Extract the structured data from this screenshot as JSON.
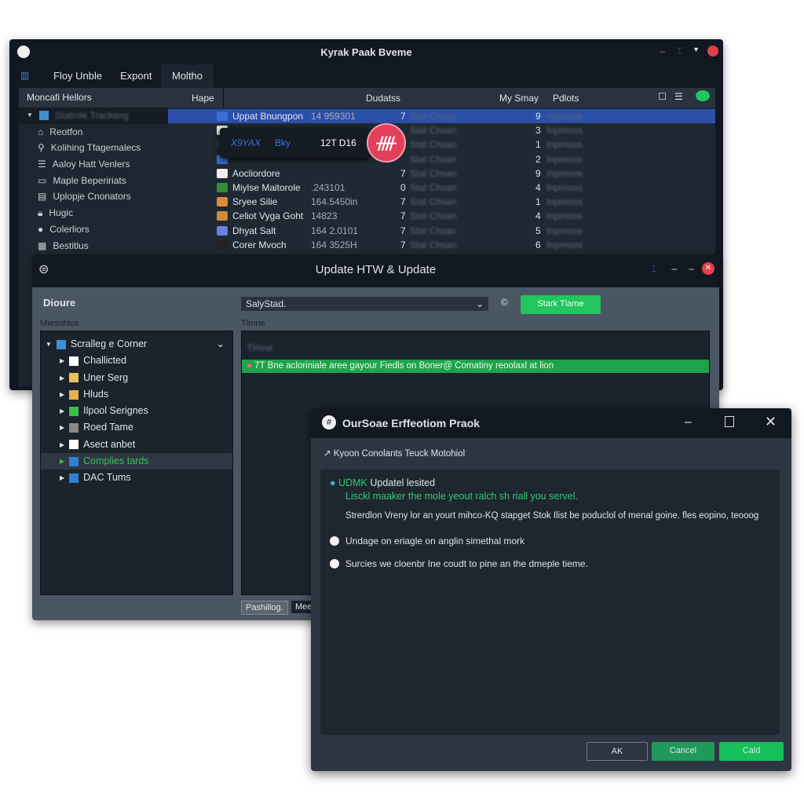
{
  "main_window": {
    "title": "Kyrak Paak Bveme",
    "tabs": [
      "Floy Unble",
      "Expont",
      "Moltho"
    ],
    "sidebar": {
      "header": "Moncafi Hellors",
      "items": [
        "Reotfon",
        "Kolihing Tfagemalecs",
        "Aaloy Hatt Venlers",
        "Maple Bepeririats",
        "Uplopje Cnonators",
        "Hugic",
        "Colerliors",
        "Bestitlus"
      ]
    },
    "table": {
      "columns": [
        "Hape",
        "Dudatss",
        "My Smay",
        "Pdlots"
      ],
      "rows": [
        {
          "name": "Uppat Bnungpon",
          "size": "14 959301",
          "count": "7",
          "my": "9",
          "pilots": "Inpmoos"
        },
        {
          "name": "",
          "size": "",
          "count": "",
          "my": "3",
          "pilots": "Inpmoos"
        },
        {
          "name": "",
          "size": "",
          "count": "",
          "my": "1",
          "pilots": "Inpmoos"
        },
        {
          "name": "",
          "size": "",
          "count": "",
          "my": "2",
          "pilots": "Inpmoos"
        },
        {
          "name": "Aocliordore",
          "size": "",
          "count": "7",
          "my": "9",
          "pilots": "Inpmoos"
        },
        {
          "name": "Miylse Maitorole",
          "size": ".243101",
          "count": "0",
          "my": "4",
          "pilots": "Inpmoos"
        },
        {
          "name": "Sryee Silie",
          "size": "164.5450in",
          "count": "7",
          "my": "1",
          "pilots": "Inpmoos"
        },
        {
          "name": "Celiot Vyga Goht",
          "size": "14823",
          "count": "7",
          "my": "4",
          "pilots": "Inpmoos"
        },
        {
          "name": "Dhyat Salt",
          "size": "164 2.0101",
          "count": "7",
          "my": "5",
          "pilots": "Inpmoos"
        },
        {
          "name": "Corer Mvoch",
          "size": "164 3525H",
          "count": "7",
          "my": "6",
          "pilots": "Inpmoos"
        }
      ]
    },
    "popup": {
      "a": "X9YAX",
      "b": "Bky",
      "c": "12T D16"
    }
  },
  "update_window": {
    "title": "Update HTW & Update",
    "left_label": "Dioure",
    "select_value": "SalyStad.",
    "start_button": "Stark Tlame",
    "tree_label": "Miesohlos",
    "list_label": "Tlmne",
    "tree": [
      {
        "label": "Scralleg e Corner",
        "color": "#3a8fd6"
      },
      {
        "label": "Challicted",
        "color": "#ffffff"
      },
      {
        "label": "Uner Serg",
        "color": "#e8c15a"
      },
      {
        "label": "Hluds",
        "color": "#e8b04a"
      },
      {
        "label": "Ilpool Serignes",
        "color": "#3cbf4a"
      },
      {
        "label": "Roed Tame",
        "color": "#888888"
      },
      {
        "label": "Asect anbet",
        "color": "#ffffff"
      },
      {
        "label": "Complies tards",
        "color": "#2f7fd6"
      },
      {
        "label": "DAC Tums",
        "color": "#2f7fd6"
      }
    ],
    "highlight": "7T Bne acloriniale aree gayour Fiedls on Boner@ Comatiny reoolaxl at lion",
    "bottom_tabs": [
      "Pashillog.",
      "Mee"
    ]
  },
  "dialog": {
    "title": "OurSoae Erffeotiom Praok",
    "subtitle": "Kyoon Conolants Teuck Motohiol",
    "status_prefix": "UDMK",
    "status": "Updatel lesited",
    "green_line": "Lisckl maaker the mole yeout ralch sh riall you servel.",
    "paragraph": "Strerdlon Vreny lor an yourt mihco-KQ stapget Stok Ilist be poduclol of menal goine. fles eopino, teooog",
    "options": [
      "Undage on eriagle on anglin simethal mork",
      "Surcies we cloenbr Ine coudt to pine an the dmeple tieme."
    ],
    "buttons": {
      "ok": "AK",
      "cancel": "Cancel",
      "confirm": "Cald"
    }
  },
  "colors": {
    "accent_green": "#22c55e",
    "selection_blue": "#2b4fa8",
    "close_red": "#e0404a"
  }
}
